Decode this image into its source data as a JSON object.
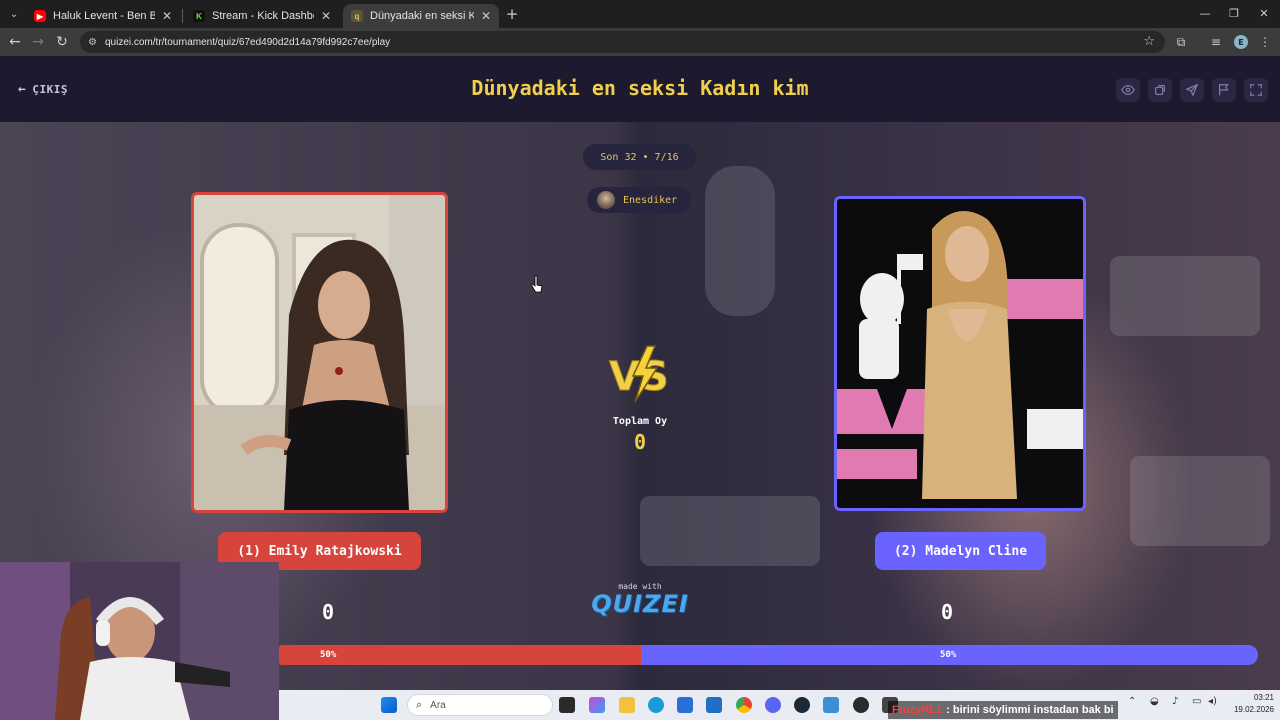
{
  "browser": {
    "tabs": [
      {
        "title": "Haluk Levent - Ben Bu Gece Öl",
        "favicon": "youtube-icon",
        "color": "#ff0000",
        "active": false
      },
      {
        "title": "Stream - Kick Dashboard",
        "favicon": "kick-icon",
        "color": "#53fc18",
        "active": false
      },
      {
        "title": "Dünyadaki en seksi Kadın kim",
        "favicon": "quizei-icon",
        "color": "#8c7a3e",
        "active": true
      }
    ],
    "url": "quizei.com/tr/tournament/quiz/67ed490d2d14a79fd992c7ee/play",
    "profile_initial": "E"
  },
  "header": {
    "exit_label": "ÇIKIŞ",
    "title": "Dünyadaki en seksi Kadın kim",
    "actions": [
      "eye-icon",
      "share-icon",
      "send-icon",
      "flag-icon",
      "fullscreen-icon"
    ]
  },
  "round": {
    "label": "Son 32 • 7/16",
    "username": "Enesdiker"
  },
  "contestants": {
    "left": {
      "label": "(1) Emily Ratajkowski",
      "votes": "0",
      "percent_label": "50%",
      "percent": 50,
      "color": "#d6443c"
    },
    "right": {
      "label": "(2) Madelyn Cline",
      "votes": "0",
      "percent_label": "50%",
      "percent": 50,
      "color": "#6b63ff"
    }
  },
  "total": {
    "label": "Toplam Oy",
    "value": "0"
  },
  "branding": {
    "made_with": "made with",
    "logo": "QUIZEI"
  },
  "taskbar": {
    "search_placeholder": "Ara",
    "ticker_user": "FrozyRL1",
    "ticker_message": ": birini söylimmi instadan bak bi",
    "time": "03:21",
    "date": "19.02.2026"
  }
}
